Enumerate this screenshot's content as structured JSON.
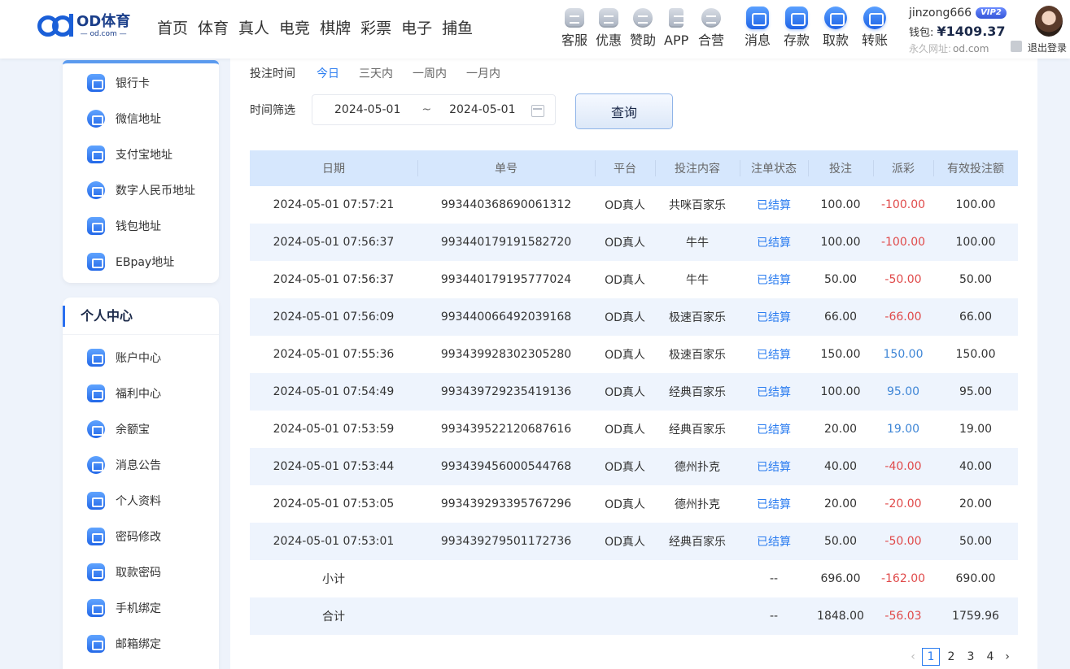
{
  "brand": {
    "logo_name": "OD体育",
    "logo_sub": "— od.com —"
  },
  "nav": [
    "首页",
    "体育",
    "真人",
    "电竞",
    "棋牌",
    "彩票",
    "电子",
    "捕鱼"
  ],
  "quick_links": [
    {
      "label": "客服",
      "icon": "chat-icon"
    },
    {
      "label": "优惠",
      "icon": "gift-icon"
    },
    {
      "label": "赞助",
      "icon": "medal-icon"
    },
    {
      "label": "APP",
      "icon": "phone-icon"
    },
    {
      "label": "合营",
      "icon": "handshake-icon"
    }
  ],
  "account_actions": [
    {
      "label": "消息",
      "icon": "mail-icon"
    },
    {
      "label": "存款",
      "icon": "wallet-icon"
    },
    {
      "label": "取款",
      "icon": "withdraw-icon"
    },
    {
      "label": "转账",
      "icon": "transfer-icon"
    }
  ],
  "user": {
    "username": "jinzong666",
    "vip": "VIP2",
    "wallet_label": "钱包:",
    "balance": "¥1409.37",
    "permanent_label": "永久网址:",
    "permanent_url": "od.com",
    "logout": "退出登录"
  },
  "sidebar": {
    "top_items": [
      {
        "label": "银行卡",
        "icon": "bank-card-icon"
      },
      {
        "label": "微信地址",
        "icon": "wechat-icon"
      },
      {
        "label": "支付宝地址",
        "icon": "alipay-icon"
      },
      {
        "label": "数字人民币地址",
        "icon": "digital-rmb-icon"
      },
      {
        "label": "钱包地址",
        "icon": "crypto-wallet-icon"
      },
      {
        "label": "EBpay地址",
        "icon": "ebpay-icon"
      }
    ],
    "section_title": "个人中心",
    "center_items": [
      {
        "label": "账户中心",
        "icon": "account-icon"
      },
      {
        "label": "福利中心",
        "icon": "welfare-icon"
      },
      {
        "label": "余额宝",
        "icon": "piggy-bank-icon"
      },
      {
        "label": "消息公告",
        "icon": "bell-icon"
      },
      {
        "label": "个人资料",
        "icon": "profile-icon"
      },
      {
        "label": "密码修改",
        "icon": "lock-icon"
      },
      {
        "label": "取款密码",
        "icon": "withdraw-lock-icon"
      },
      {
        "label": "手机绑定",
        "icon": "phone-bind-icon"
      },
      {
        "label": "邮箱绑定",
        "icon": "email-bind-icon"
      }
    ]
  },
  "filters": {
    "bet_time_label": "投注时间",
    "ranges": [
      "今日",
      "三天内",
      "一周内",
      "一月内"
    ],
    "active_range": "今日",
    "time_filter_label": "时间筛选",
    "start_date": "2024-05-01",
    "separator": "~",
    "end_date": "2024-05-01",
    "query_button": "查询"
  },
  "table": {
    "headers": [
      "日期",
      "单号",
      "平台",
      "投注内容",
      "注单状态",
      "投注",
      "派彩",
      "有效投注额"
    ],
    "rows": [
      [
        "2024-05-01 07:57:21",
        "993440368690061312",
        "OD真人",
        "共咪百家乐",
        "已结算",
        "100.00",
        "-100.00",
        "100.00"
      ],
      [
        "2024-05-01 07:56:37",
        "993440179191582720",
        "OD真人",
        "牛牛",
        "已结算",
        "100.00",
        "-100.00",
        "100.00"
      ],
      [
        "2024-05-01 07:56:37",
        "993440179195777024",
        "OD真人",
        "牛牛",
        "已结算",
        "50.00",
        "-50.00",
        "50.00"
      ],
      [
        "2024-05-01 07:56:09",
        "993440066492039168",
        "OD真人",
        "极速百家乐",
        "已结算",
        "66.00",
        "-66.00",
        "66.00"
      ],
      [
        "2024-05-01 07:55:36",
        "993439928302305280",
        "OD真人",
        "极速百家乐",
        "已结算",
        "150.00",
        "150.00",
        "150.00"
      ],
      [
        "2024-05-01 07:54:49",
        "993439729235419136",
        "OD真人",
        "经典百家乐",
        "已结算",
        "100.00",
        "95.00",
        "95.00"
      ],
      [
        "2024-05-01 07:53:59",
        "993439522120687616",
        "OD真人",
        "经典百家乐",
        "已结算",
        "20.00",
        "19.00",
        "19.00"
      ],
      [
        "2024-05-01 07:53:44",
        "993439456000544768",
        "OD真人",
        "德州扑克",
        "已结算",
        "40.00",
        "-40.00",
        "40.00"
      ],
      [
        "2024-05-01 07:53:05",
        "993439293395767296",
        "OD真人",
        "德州扑克",
        "已结算",
        "20.00",
        "-20.00",
        "20.00"
      ],
      [
        "2024-05-01 07:53:01",
        "993439279501172736",
        "OD真人",
        "经典百家乐",
        "已结算",
        "50.00",
        "-50.00",
        "50.00"
      ]
    ],
    "subtotal": {
      "label": "小计",
      "status": "--",
      "bet": "696.00",
      "payout": "-162.00",
      "valid": "690.00"
    },
    "total": {
      "label": "合计",
      "status": "--",
      "bet": "1848.00",
      "payout": "-56.03",
      "valid": "1759.96"
    }
  },
  "pagination": {
    "pages": [
      "1",
      "2",
      "3",
      "4"
    ],
    "current": "1",
    "prev": "‹",
    "next": "›"
  },
  "colors": {
    "accent": "#2a7cf0",
    "negative": "#e04a4a",
    "positive": "#3f86d6",
    "header_bg": "#d6e7fd"
  }
}
